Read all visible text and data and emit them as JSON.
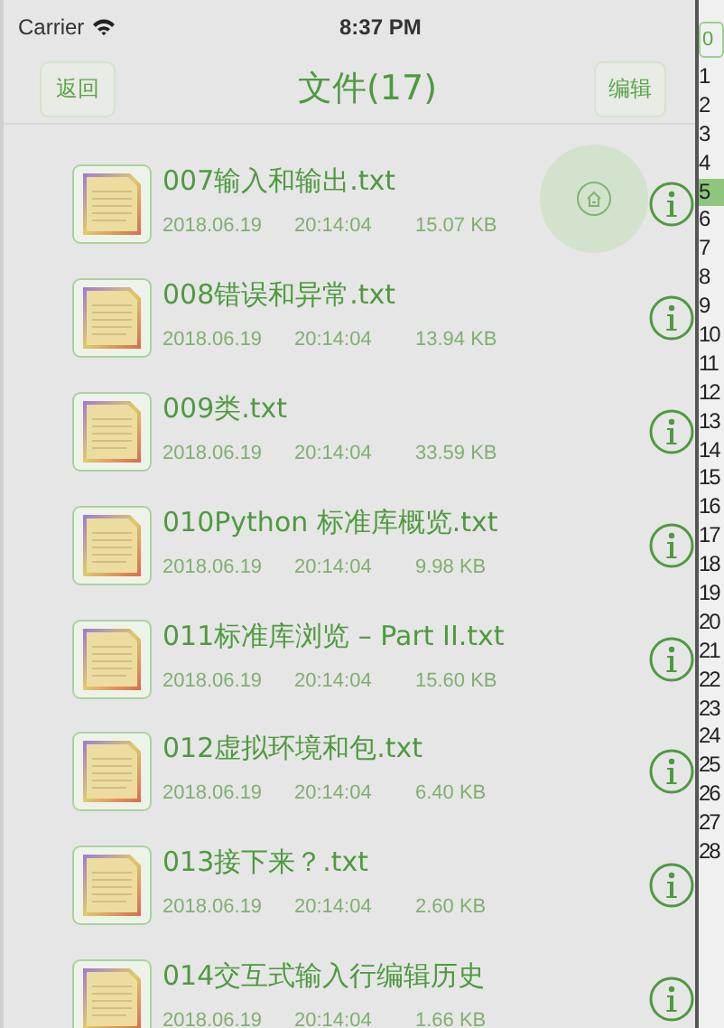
{
  "status_bar": {
    "carrier": "Carrier",
    "time": "8:37 PM"
  },
  "nav": {
    "back": "返回",
    "title": "文件(17)",
    "edit": "编辑"
  },
  "files": [
    {
      "name": "007输入和输出.txt",
      "date": "2018.06.19",
      "time": "20:14:04",
      "size": "15.07 KB"
    },
    {
      "name": "008错误和异常.txt",
      "date": "2018.06.19",
      "time": "20:14:04",
      "size": "13.94 KB"
    },
    {
      "name": "009类.txt",
      "date": "2018.06.19",
      "time": "20:14:04",
      "size": "33.59 KB"
    },
    {
      "name": "010Python 标准库概览.txt",
      "date": "2018.06.19",
      "time": "20:14:04",
      "size": "9.98 KB"
    },
    {
      "name": "011标准库浏览 – Part II.txt",
      "date": "2018.06.19",
      "time": "20:14:04",
      "size": "15.60 KB"
    },
    {
      "name": "012虚拟环境和包.txt",
      "date": "2018.06.19",
      "time": "20:14:04",
      "size": "6.40 KB"
    },
    {
      "name": "013接下来？.txt",
      "date": "2018.06.19",
      "time": "20:14:04",
      "size": "2.60 KB"
    },
    {
      "name": "014交互式输入行编辑历史",
      "date": "2018.06.19",
      "time": "20:14:04",
      "size": "1.66 KB"
    }
  ],
  "line_index": {
    "chip": "0",
    "lines": [
      {
        "label": "1",
        "selected": false
      },
      {
        "label": "2",
        "selected": false
      },
      {
        "label": "3",
        "selected": false
      },
      {
        "label": "4",
        "selected": false
      },
      {
        "label": "5",
        "selected": true
      },
      {
        "label": "6",
        "selected": false
      },
      {
        "label": "7",
        "selected": false
      },
      {
        "label": "8",
        "selected": false
      },
      {
        "label": "9",
        "selected": false
      },
      {
        "label": "10",
        "selected": false
      },
      {
        "label": "11",
        "selected": false
      },
      {
        "label": "12",
        "selected": false
      },
      {
        "label": "13",
        "selected": false
      },
      {
        "label": "14",
        "selected": false
      },
      {
        "label": "15",
        "selected": false
      },
      {
        "label": "16",
        "selected": false
      },
      {
        "label": "17",
        "selected": false
      },
      {
        "label": "18",
        "selected": false
      },
      {
        "label": "19",
        "selected": false
      },
      {
        "label": "20",
        "selected": false
      },
      {
        "label": "21",
        "selected": false
      },
      {
        "label": "22",
        "selected": false
      },
      {
        "label": "23",
        "selected": false
      },
      {
        "label": "24",
        "selected": false
      },
      {
        "label": "25",
        "selected": false
      },
      {
        "label": "26",
        "selected": false
      },
      {
        "label": "27",
        "selected": false
      },
      {
        "label": "28",
        "selected": false
      }
    ]
  }
}
